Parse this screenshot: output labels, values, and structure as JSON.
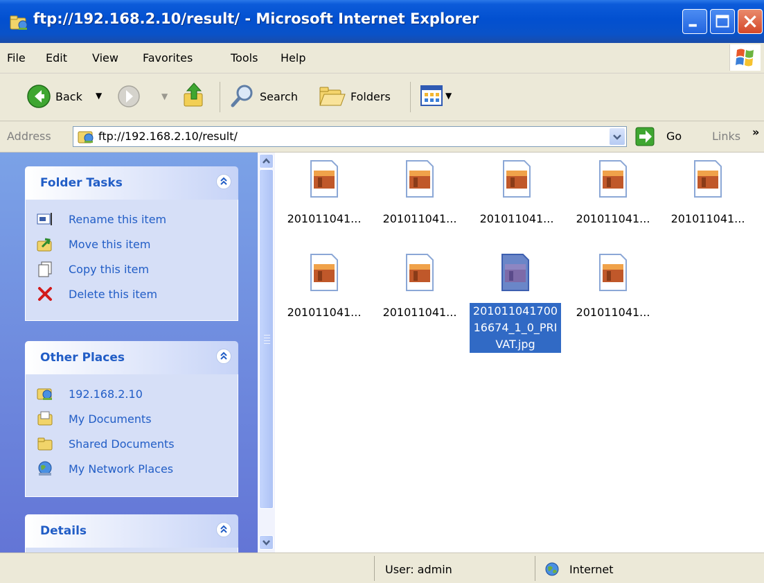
{
  "window": {
    "title": "ftp://192.168.2.10/result/ - Microsoft Internet Explorer"
  },
  "menu": [
    {
      "label": "File"
    },
    {
      "label": "Edit"
    },
    {
      "label": "View"
    },
    {
      "label": "Favorites"
    },
    {
      "label": "Tools"
    },
    {
      "label": "Help"
    }
  ],
  "toolbar": {
    "back_label": "Back",
    "search_label": "Search",
    "folders_label": "Folders"
  },
  "address": {
    "label": "Address",
    "url": "ftp://192.168.2.10/result/",
    "go_label": "Go",
    "links_label": "Links"
  },
  "folder_tasks": {
    "title": "Folder Tasks",
    "items": [
      {
        "label": "Rename this item",
        "icon": "rename-icon"
      },
      {
        "label": "Move this item",
        "icon": "move-icon"
      },
      {
        "label": "Copy this item",
        "icon": "copy-icon"
      },
      {
        "label": "Delete this item",
        "icon": "delete-icon"
      }
    ]
  },
  "other_places": {
    "title": "Other Places",
    "items": [
      {
        "label": "192.168.2.10",
        "icon": "ftp-server-icon"
      },
      {
        "label": "My Documents",
        "icon": "my-documents-icon"
      },
      {
        "label": "Shared Documents",
        "icon": "shared-documents-icon"
      },
      {
        "label": "My Network Places",
        "icon": "network-places-icon"
      }
    ]
  },
  "details": {
    "title": "Details"
  },
  "files": [
    {
      "name": "201011041...",
      "selected": false
    },
    {
      "name": "201011041...",
      "selected": false
    },
    {
      "name": "201011041...",
      "selected": false
    },
    {
      "name": "201011041...",
      "selected": false
    },
    {
      "name": "201011041...",
      "selected": false
    },
    {
      "name": "201011041...",
      "selected": false
    },
    {
      "name": "201011041...",
      "selected": false
    },
    {
      "name": "20101104170016674_1_0_PRIVAT.jpg",
      "selected": true
    },
    {
      "name": "201011041...",
      "selected": false
    }
  ],
  "status": {
    "user": "User: admin",
    "zone": "Internet"
  },
  "colors": {
    "title_bar": "#0250d0",
    "task_pane": "#6375d6",
    "link_text": "#215dc6",
    "selection": "#316ac5"
  }
}
